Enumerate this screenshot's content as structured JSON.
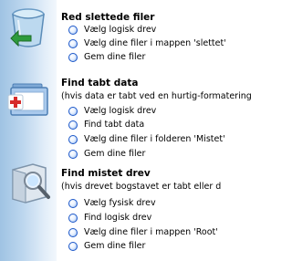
{
  "sections": [
    {
      "title": "Red slettede filer",
      "description": "",
      "options": [
        "Vælg logisk drev",
        "Vælg dine filer i mappen 'slettet'",
        "Gem dine filer"
      ]
    },
    {
      "title": "Find tabt data",
      "description": "(hvis data er tabt ved en hurtig-formatering",
      "options": [
        "Vælg logisk drev",
        "Find tabt data",
        "Vælg dine filer i folderen 'Mistet'",
        "Gem dine filer"
      ]
    },
    {
      "title": "Find mistet drev",
      "description": "(hvis drevet bogstavet er tabt eller d",
      "options": [
        "Vælg fysisk drev",
        "Find logisk drev",
        "Vælg dine filer i mappen 'Root'",
        "Gem dine filer"
      ]
    }
  ],
  "icons": {
    "recycle_bin": "recycle-bin-icon",
    "folder_plus": "folder-plus-icon",
    "drive_search": "drive-search-icon"
  },
  "colors": {
    "sidebar_start": "#9fc3e3",
    "sidebar_end": "#f2f7fc",
    "radio_border": "#1a56c8"
  }
}
